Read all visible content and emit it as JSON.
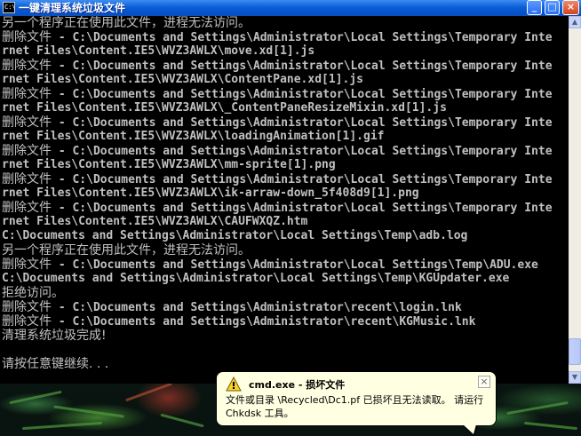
{
  "window": {
    "title": "一键清理系统垃圾文件",
    "icon": "C:\\",
    "icon_name": "cmd-icon",
    "buttons": {
      "minimize": "_",
      "maximize": "□",
      "close": "×"
    }
  },
  "console": {
    "lines": [
      {
        "text": "另一个程序正在使用此文件，进程无法访问。",
        "cjk": true
      },
      {
        "prefix": "删除文件",
        "text": " - C:\\Documents and Settings\\Administrator\\Local Settings\\Temporary Inte"
      },
      {
        "text": "rnet Files\\Content.IE5\\WVZ3AWLX\\move.xd[1].js"
      },
      {
        "prefix": "删除文件",
        "text": " - C:\\Documents and Settings\\Administrator\\Local Settings\\Temporary Inte"
      },
      {
        "text": "rnet Files\\Content.IE5\\WVZ3AWLX\\ContentPane.xd[1].js"
      },
      {
        "prefix": "删除文件",
        "text": " - C:\\Documents and Settings\\Administrator\\Local Settings\\Temporary Inte"
      },
      {
        "text": "rnet Files\\Content.IE5\\WVZ3AWLX\\_ContentPaneResizeMixin.xd[1].js"
      },
      {
        "prefix": "删除文件",
        "text": " - C:\\Documents and Settings\\Administrator\\Local Settings\\Temporary Inte"
      },
      {
        "text": "rnet Files\\Content.IE5\\WVZ3AWLX\\loadingAnimation[1].gif"
      },
      {
        "prefix": "删除文件",
        "text": " - C:\\Documents and Settings\\Administrator\\Local Settings\\Temporary Inte"
      },
      {
        "text": "rnet Files\\Content.IE5\\WVZ3AWLX\\mm-sprite[1].png"
      },
      {
        "prefix": "删除文件",
        "text": " - C:\\Documents and Settings\\Administrator\\Local Settings\\Temporary Inte"
      },
      {
        "text": "rnet Files\\Content.IE5\\WVZ3AWLX\\ik-arraw-down_5f408d9[1].png"
      },
      {
        "prefix": "删除文件",
        "text": " - C:\\Documents and Settings\\Administrator\\Local Settings\\Temporary Inte"
      },
      {
        "text": "rnet Files\\Content.IE5\\WVZ3AWLX\\CAUFWXQZ.htm"
      },
      {
        "text": "C:\\Documents and Settings\\Administrator\\Local Settings\\Temp\\adb.log"
      },
      {
        "text": "另一个程序正在使用此文件，进程无法访问。",
        "cjk": true
      },
      {
        "prefix": "删除文件",
        "text": " - C:\\Documents and Settings\\Administrator\\Local Settings\\Temp\\ADU.exe"
      },
      {
        "text": "C:\\Documents and Settings\\Administrator\\Local Settings\\Temp\\KGUpdater.exe"
      },
      {
        "text": "拒绝访问。",
        "cjk": true
      },
      {
        "prefix": "删除文件",
        "text": " - C:\\Documents and Settings\\Administrator\\recent\\login.lnk"
      },
      {
        "prefix": "删除文件",
        "text": " - C:\\Documents and Settings\\Administrator\\recent\\KGMusic.lnk"
      },
      {
        "text": "清理系统垃圾完成!",
        "cjk": true
      },
      {
        "text": "",
        "cjk": true
      },
      {
        "text": "请按任意键继续. . .",
        "cjk": true
      }
    ]
  },
  "scrollbar": {
    "up_arrow": "▲",
    "down_arrow": "▼",
    "position_fraction": 0.97
  },
  "balloon": {
    "icon_name": "warning-icon",
    "title": "cmd.exe - 损坏文件",
    "body": "文件或目录 \\Recycled\\Dc1.pf 已损坏且无法读取。 请运行 Chkdsk 工具。",
    "close": "×"
  },
  "colors": {
    "titlebar": "#0a5fd8",
    "console_bg": "#000000",
    "console_text": "#c0c0c0",
    "balloon_bg": "#ffffe1"
  }
}
